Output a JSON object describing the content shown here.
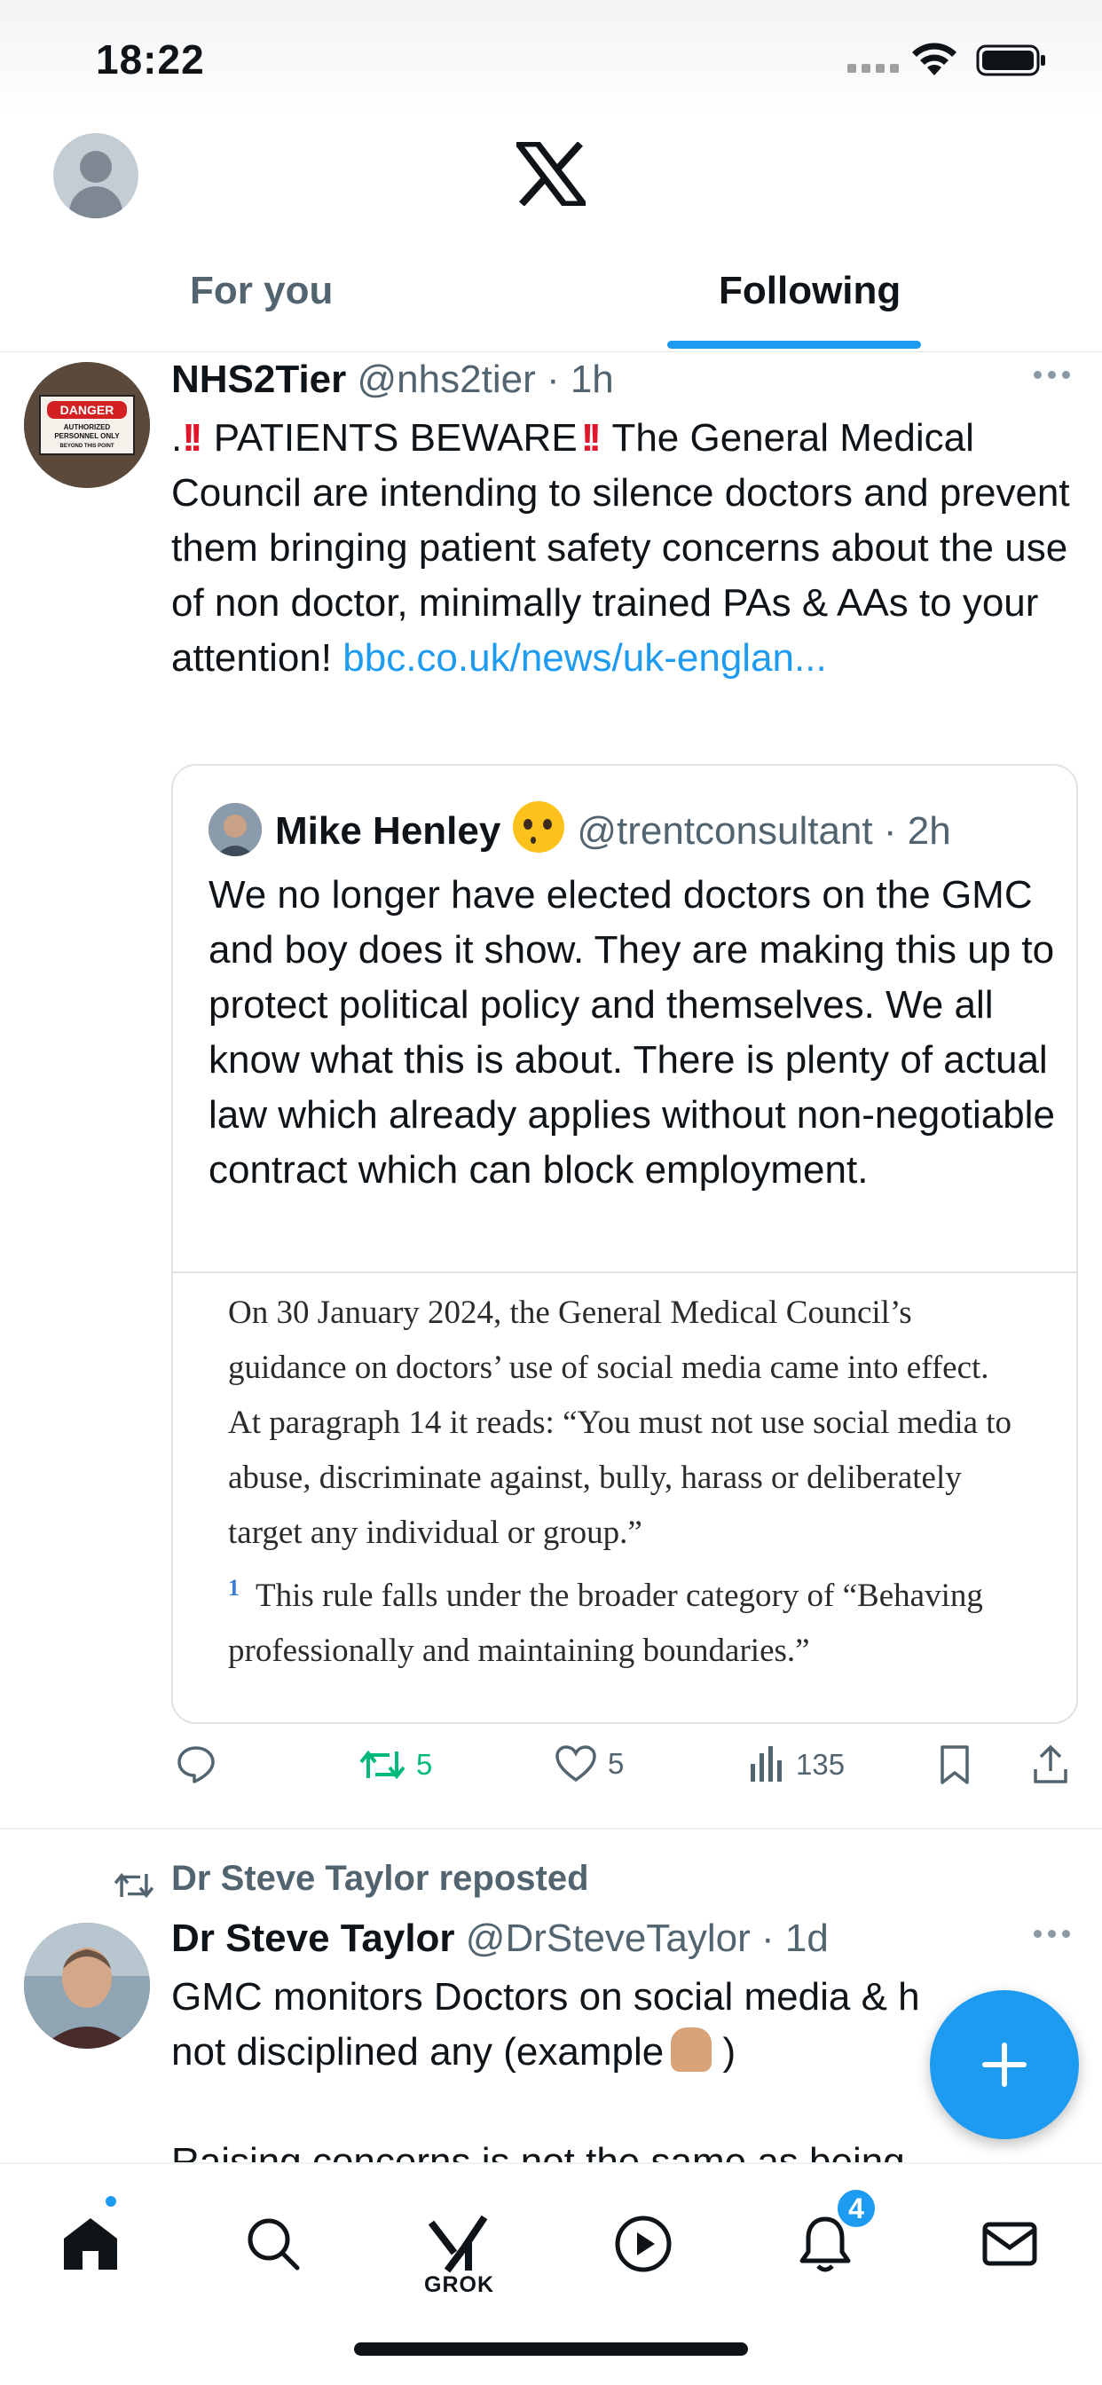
{
  "status_bar": {
    "time": "18:22"
  },
  "header": {
    "logo": "x-logo"
  },
  "tabs": [
    {
      "label": "For you",
      "active": false
    },
    {
      "label": "Following",
      "active": true
    }
  ],
  "tweet1": {
    "name": "NHS2Tier",
    "handle": "@nhs2tier",
    "time": "1h",
    "text_prefix": ".",
    "text_alert": "PATIENTS BEWARE",
    "text_main": "The General Medical Council are intending to silence doctors and prevent them bringing patient safety concerns about the use of non doctor, minimally trained PAs & AAs to your attention!",
    "link": "bbc.co.uk/news/uk-englan...",
    "avatar_sign": {
      "title": "DANGER",
      "lines": [
        "AUTHORIZED",
        "PERSONNEL ONLY",
        "BEYOND THIS POINT"
      ]
    },
    "quote": {
      "name": "Mike Henley",
      "handle": "@trentconsultant",
      "time": "2h",
      "text": "We no longer have elected doctors on the GMC and boy does it show. They are making this up to protect political policy and themselves. We all know what this is about. There is plenty of actual law which already applies without non-negotiable contract which can block employment.",
      "media_text": "On 30 January 2024, the General Medical Council’s guidance on doctors’ use of social media came into effect. At paragraph 14 it reads: “You must not use social media to abuse, discriminate against, bully, harass or deliberately target any individual or group.”",
      "media_sup": "1",
      "media_text2": "This rule falls under the broader category of “Behaving professionally and maintaining boundaries.”"
    },
    "actions": {
      "replies": "",
      "reposts": "5",
      "likes": "5",
      "views": "135"
    }
  },
  "tweet2": {
    "repost_by": "Dr Steve Taylor reposted",
    "name": "Dr Steve Taylor",
    "handle": "@DrSteveTaylor",
    "time": "1d",
    "text_line1": "GMC monitors Doctors on social media & h",
    "text_line2": "not disciplined any (example",
    "text_line2_end": ")",
    "text_line3": "Raising concerns is not the same as being"
  },
  "nav": {
    "items": [
      "home",
      "search",
      "grok",
      "video",
      "notifications",
      "messages"
    ],
    "grok_label": "GROK",
    "notifications_badge": "4"
  },
  "colors": {
    "accent": "#1d9bf0",
    "repost_green": "#00ba7c",
    "alert_red": "#e0162b"
  }
}
